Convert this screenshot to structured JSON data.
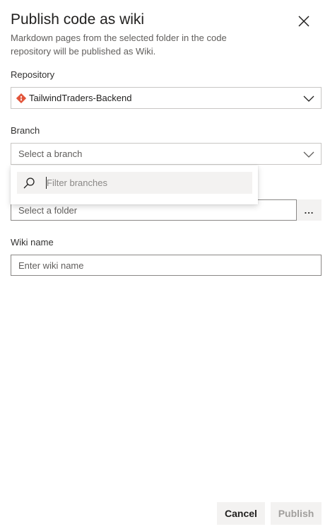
{
  "header": {
    "title": "Publish code as wiki",
    "description": "Markdown pages from the selected folder in the code repository will be published as Wiki."
  },
  "repository": {
    "label": "Repository",
    "value": "TailwindTraders-Backend"
  },
  "branch": {
    "label": "Branch",
    "placeholder": "Select a branch",
    "dropdown": {
      "filter_placeholder": "Filter branches"
    }
  },
  "folder": {
    "placeholder": "Select a folder",
    "browse_label": "..."
  },
  "wiki": {
    "label": "Wiki name",
    "placeholder": "Enter wiki name"
  },
  "footer": {
    "cancel_label": "Cancel",
    "publish_label": "Publish"
  },
  "colors": {
    "repo_icon": "#e2553b",
    "border": "#c8c6c4",
    "disabled_text": "#a19f9d"
  }
}
